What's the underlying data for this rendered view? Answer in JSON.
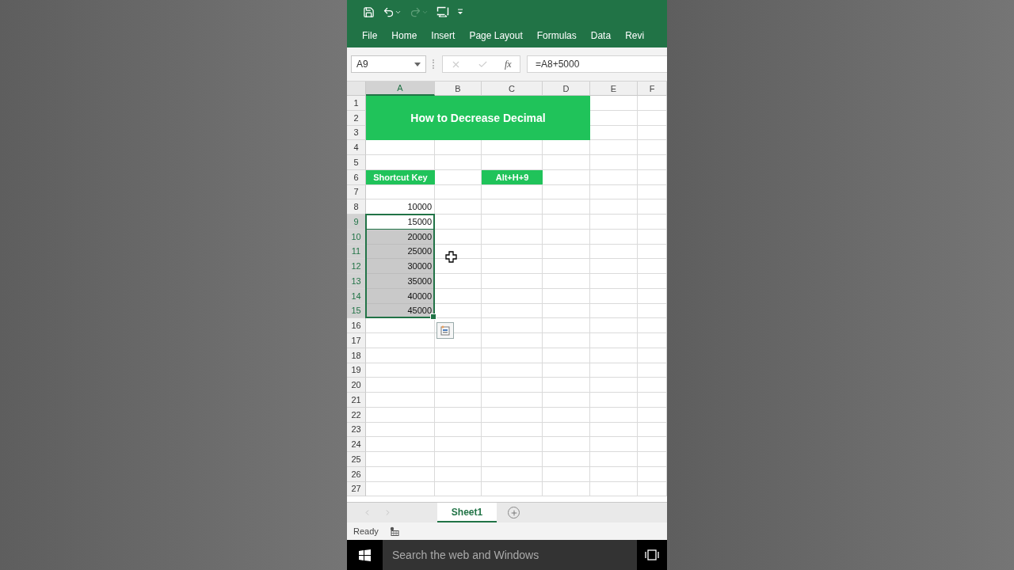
{
  "ribbon_tabs": [
    {
      "label": "File"
    },
    {
      "label": "Home"
    },
    {
      "label": "Insert"
    },
    {
      "label": "Page Layout"
    },
    {
      "label": "Formulas"
    },
    {
      "label": "Data"
    },
    {
      "label": "Revi"
    }
  ],
  "formula_bar": {
    "name_box": "A9",
    "fx": "fx",
    "formula": "=A8+5000"
  },
  "columns": [
    {
      "label": "A",
      "selected": true
    },
    {
      "label": "B",
      "selected": false
    },
    {
      "label": "C",
      "selected": false
    },
    {
      "label": "D",
      "selected": false
    },
    {
      "label": "E",
      "selected": false
    },
    {
      "label": "F",
      "selected": false
    }
  ],
  "rows": [
    {
      "label": "1",
      "selected": false,
      "cells": [
        {
          "kind": "title",
          "text": "How to Decrease Decimal",
          "selected": false,
          "active": false
        }
      ]
    },
    {
      "label": "2",
      "selected": false
    },
    {
      "label": "3",
      "selected": false
    },
    {
      "label": "4",
      "selected": false
    },
    {
      "label": "5",
      "selected": false
    },
    {
      "label": "6",
      "selected": false,
      "cells": [
        {
          "kind": "header",
          "text": "Shortcut Key",
          "selected": false,
          "active": false
        },
        {
          "kind": "blank"
        },
        {
          "kind": "header",
          "text": "Alt+H+9",
          "selected": false,
          "active": false
        }
      ]
    },
    {
      "label": "7",
      "selected": false
    },
    {
      "label": "8",
      "selected": false,
      "cells": [
        {
          "kind": "number",
          "text": "10000",
          "selected": false,
          "active": false
        }
      ]
    },
    {
      "label": "9",
      "selected": true,
      "cells": [
        {
          "kind": "number",
          "text": "15000",
          "selected": true,
          "active": true
        }
      ]
    },
    {
      "label": "10",
      "selected": true,
      "cells": [
        {
          "kind": "number",
          "text": "20000",
          "selected": true,
          "active": false
        }
      ]
    },
    {
      "label": "11",
      "selected": true,
      "cells": [
        {
          "kind": "number",
          "text": "25000",
          "selected": true,
          "active": false
        }
      ]
    },
    {
      "label": "12",
      "selected": true,
      "cells": [
        {
          "kind": "number",
          "text": "30000",
          "selected": true,
          "active": false
        }
      ]
    },
    {
      "label": "13",
      "selected": true,
      "cells": [
        {
          "kind": "number",
          "text": "35000",
          "selected": true,
          "active": false
        }
      ]
    },
    {
      "label": "14",
      "selected": true,
      "cells": [
        {
          "kind": "number",
          "text": "40000",
          "selected": true,
          "active": false
        }
      ]
    },
    {
      "label": "15",
      "selected": true,
      "cells": [
        {
          "kind": "number",
          "text": "45000",
          "selected": true,
          "active": false
        }
      ]
    },
    {
      "label": "16",
      "selected": false
    },
    {
      "label": "17",
      "selected": false
    },
    {
      "label": "18",
      "selected": false
    },
    {
      "label": "19",
      "selected": false
    },
    {
      "label": "20",
      "selected": false
    },
    {
      "label": "21",
      "selected": false
    },
    {
      "label": "22",
      "selected": false
    },
    {
      "label": "23",
      "selected": false
    },
    {
      "label": "24",
      "selected": false
    },
    {
      "label": "25",
      "selected": false
    },
    {
      "label": "26",
      "selected": false
    },
    {
      "label": "27",
      "selected": false
    }
  ],
  "sheet_tabs": [
    {
      "label": "Sheet1",
      "selected": true
    }
  ],
  "status_bar": {
    "text": "Ready"
  },
  "taskbar": {
    "search_placeholder": "Search the web and Windows"
  }
}
